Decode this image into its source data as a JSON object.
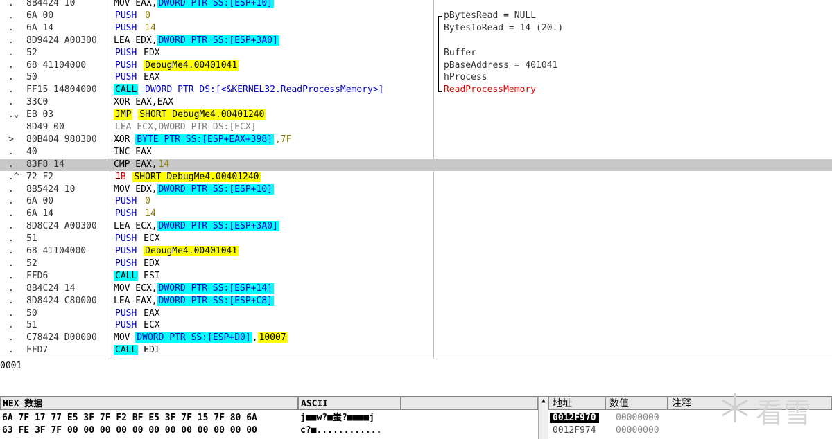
{
  "disasm": {
    "rows": [
      {
        "mark": ".",
        "hex": "8B4424 10",
        "segs": [
          {
            "t": "MOV EAX,",
            "c": ""
          },
          {
            "t": "DWORD PTR SS:[ESP+10]",
            "c": "cyanB"
          }
        ],
        "comment": ""
      },
      {
        "mark": ".",
        "hex": "6A 00",
        "segs": [
          {
            "t": "PUSH",
            "c": "blue"
          },
          {
            "t": " 0",
            "c": "olive"
          }
        ],
        "comment": "pBytesRead = NULL"
      },
      {
        "mark": ".",
        "hex": "6A 14",
        "segs": [
          {
            "t": "PUSH",
            "c": "blue"
          },
          {
            "t": " 14",
            "c": "olive"
          }
        ],
        "comment": "BytesToRead = 14 (20.)"
      },
      {
        "mark": ".",
        "hex": "8D9424 A00300",
        "segs": [
          {
            "t": "LEA EDX,",
            "c": ""
          },
          {
            "t": "DWORD PTR SS:[ESP+3A0]",
            "c": "cyanB"
          }
        ],
        "comment": ""
      },
      {
        "mark": ".",
        "hex": "52",
        "segs": [
          {
            "t": "PUSH",
            "c": "blue"
          },
          {
            "t": " EDX",
            "c": ""
          }
        ],
        "comment": "Buffer"
      },
      {
        "mark": ".",
        "hex": "68 41104000",
        "segs": [
          {
            "t": "PUSH",
            "c": "blue"
          },
          {
            "t": " ",
            "c": ""
          },
          {
            "t": "DebugMe4.00401041",
            "c": "yel"
          }
        ],
        "comment": "pBaseAddress = 401041"
      },
      {
        "mark": ".",
        "hex": "50",
        "segs": [
          {
            "t": "PUSH",
            "c": "blue"
          },
          {
            "t": " EAX",
            "c": ""
          }
        ],
        "comment": "hProcess"
      },
      {
        "mark": ".",
        "hex": "FF15 14804000",
        "segs": [
          {
            "t": "CALL",
            "c": "cyan"
          },
          {
            "t": " DWORD PTR DS:[<&KERNEL32.ReadProcessMemory>]",
            "c": "blue"
          }
        ],
        "comment": "ReadProcessMemory",
        "commentRed": true
      },
      {
        "mark": ".",
        "hex": "33C0",
        "segs": [
          {
            "t": "XOR EAX,EAX",
            "c": ""
          }
        ],
        "comment": ""
      },
      {
        "mark": ".⌄",
        "hex": "EB 03",
        "segs": [
          {
            "t": "JMP",
            "c": "yel"
          },
          {
            "t": " ",
            "c": ""
          },
          {
            "t": "SHORT DebugMe4.00401240",
            "c": "yel"
          }
        ],
        "comment": ""
      },
      {
        "mark": "",
        "hex": "8D49 00",
        "segs": [
          {
            "t": "LEA ECX,DWORD PTR DS:[ECX]",
            "c": "grey"
          }
        ],
        "comment": ""
      },
      {
        "mark": ">",
        "hex": "80B404 980300",
        "segs": [
          {
            "t": "XOR ",
            "c": ""
          },
          {
            "t": "BYTE PTR SS:[ESP+EAX+398]",
            "c": "cyanB"
          },
          {
            "t": ",7F",
            "c": "olive"
          }
        ],
        "comment": ""
      },
      {
        "mark": ".",
        "hex": "40",
        "segs": [
          {
            "t": "INC EAX",
            "c": ""
          }
        ],
        "comment": ""
      },
      {
        "mark": ".",
        "hex": "83F8 14",
        "segs": [
          {
            "t": "CMP EAX,",
            "c": ""
          },
          {
            "t": "14",
            "c": "olive"
          }
        ],
        "comment": "",
        "selected": true
      },
      {
        "mark": ".^",
        "hex": "72 F2",
        "segs": [
          {
            "t": "JB",
            "c": "red"
          },
          {
            "t": " ",
            "c": ""
          },
          {
            "t": "SHORT DebugMe4.00401240",
            "c": "yel"
          }
        ],
        "comment": ""
      },
      {
        "mark": ".",
        "hex": "8B5424 10",
        "segs": [
          {
            "t": "MOV EDX,",
            "c": ""
          },
          {
            "t": "DWORD PTR SS:[ESP+10]",
            "c": "cyanB"
          }
        ],
        "comment": ""
      },
      {
        "mark": ".",
        "hex": "6A 00",
        "segs": [
          {
            "t": "PUSH",
            "c": "blue"
          },
          {
            "t": " 0",
            "c": "olive"
          }
        ],
        "comment": ""
      },
      {
        "mark": ".",
        "hex": "6A 14",
        "segs": [
          {
            "t": "PUSH",
            "c": "blue"
          },
          {
            "t": " 14",
            "c": "olive"
          }
        ],
        "comment": ""
      },
      {
        "mark": ".",
        "hex": "8D8C24 A00300",
        "segs": [
          {
            "t": "LEA ECX,",
            "c": ""
          },
          {
            "t": "DWORD PTR SS:[ESP+3A0]",
            "c": "cyanB"
          }
        ],
        "comment": ""
      },
      {
        "mark": ".",
        "hex": "51",
        "segs": [
          {
            "t": "PUSH",
            "c": "blue"
          },
          {
            "t": " ECX",
            "c": ""
          }
        ],
        "comment": ""
      },
      {
        "mark": ".",
        "hex": "68 41104000",
        "segs": [
          {
            "t": "PUSH",
            "c": "blue"
          },
          {
            "t": " ",
            "c": ""
          },
          {
            "t": "DebugMe4.00401041",
            "c": "yel"
          }
        ],
        "comment": ""
      },
      {
        "mark": ".",
        "hex": "52",
        "segs": [
          {
            "t": "PUSH",
            "c": "blue"
          },
          {
            "t": " EDX",
            "c": ""
          }
        ],
        "comment": ""
      },
      {
        "mark": ".",
        "hex": "FFD6",
        "segs": [
          {
            "t": "CALL",
            "c": "cyan"
          },
          {
            "t": " ESI",
            "c": ""
          }
        ],
        "comment": ""
      },
      {
        "mark": ".",
        "hex": "8B4C24 14",
        "segs": [
          {
            "t": "MOV ECX,",
            "c": ""
          },
          {
            "t": "DWORD PTR SS:[ESP+14]",
            "c": "cyanB"
          }
        ],
        "comment": ""
      },
      {
        "mark": ".",
        "hex": "8D8424 C80000",
        "segs": [
          {
            "t": "LEA EAX,",
            "c": ""
          },
          {
            "t": "DWORD PTR SS:[ESP+C8]",
            "c": "cyanB"
          }
        ],
        "comment": ""
      },
      {
        "mark": ".",
        "hex": "50",
        "segs": [
          {
            "t": "PUSH",
            "c": "blue"
          },
          {
            "t": " EAX",
            "c": ""
          }
        ],
        "comment": ""
      },
      {
        "mark": ".",
        "hex": "51",
        "segs": [
          {
            "t": "PUSH",
            "c": "blue"
          },
          {
            "t": " ECX",
            "c": ""
          }
        ],
        "comment": ""
      },
      {
        "mark": ".",
        "hex": "C78424 D00000",
        "segs": [
          {
            "t": "MOV ",
            "c": ""
          },
          {
            "t": "DWORD PTR SS:[ESP+D0]",
            "c": "cyanB"
          },
          {
            "t": ",",
            "c": ""
          },
          {
            "t": "10007",
            "c": "yel"
          }
        ],
        "comment": ""
      },
      {
        "mark": ".",
        "hex": "FFD7",
        "segs": [
          {
            "t": "CALL",
            "c": "cyan"
          },
          {
            "t": " EDI",
            "c": ""
          }
        ],
        "comment": ""
      }
    ]
  },
  "info": {
    "text": "0001"
  },
  "dump": {
    "header_hex": "HEX 数据",
    "header_ascii": "ASCII",
    "rows": [
      {
        "hex": "6A 7F 17 77 E5 3F 7F F2 BF E5 3F 7F 15 7F 80 6A",
        "ascii": "j■■w?■蚩?■■■■j"
      },
      {
        "hex": "63 FE 3F 7F 00 00 00 00 00 00 00 00 00 00 00 00",
        "ascii": "c?■............"
      }
    ]
  },
  "stack": {
    "header_addr": "地址",
    "header_value": "数值",
    "header_comment": "注释",
    "rows": [
      {
        "addr": "0012F970",
        "value": "00000000",
        "selected": true
      },
      {
        "addr": "0012F974",
        "value": "00000000",
        "selected": false
      }
    ]
  },
  "watermark": {
    "text": "看雪"
  },
  "colors": {
    "cyan": "#00ffff",
    "yellow": "#ffff00",
    "blue": "#0000c8",
    "red": "#e00000",
    "selected_row": "#c8c8c8"
  }
}
